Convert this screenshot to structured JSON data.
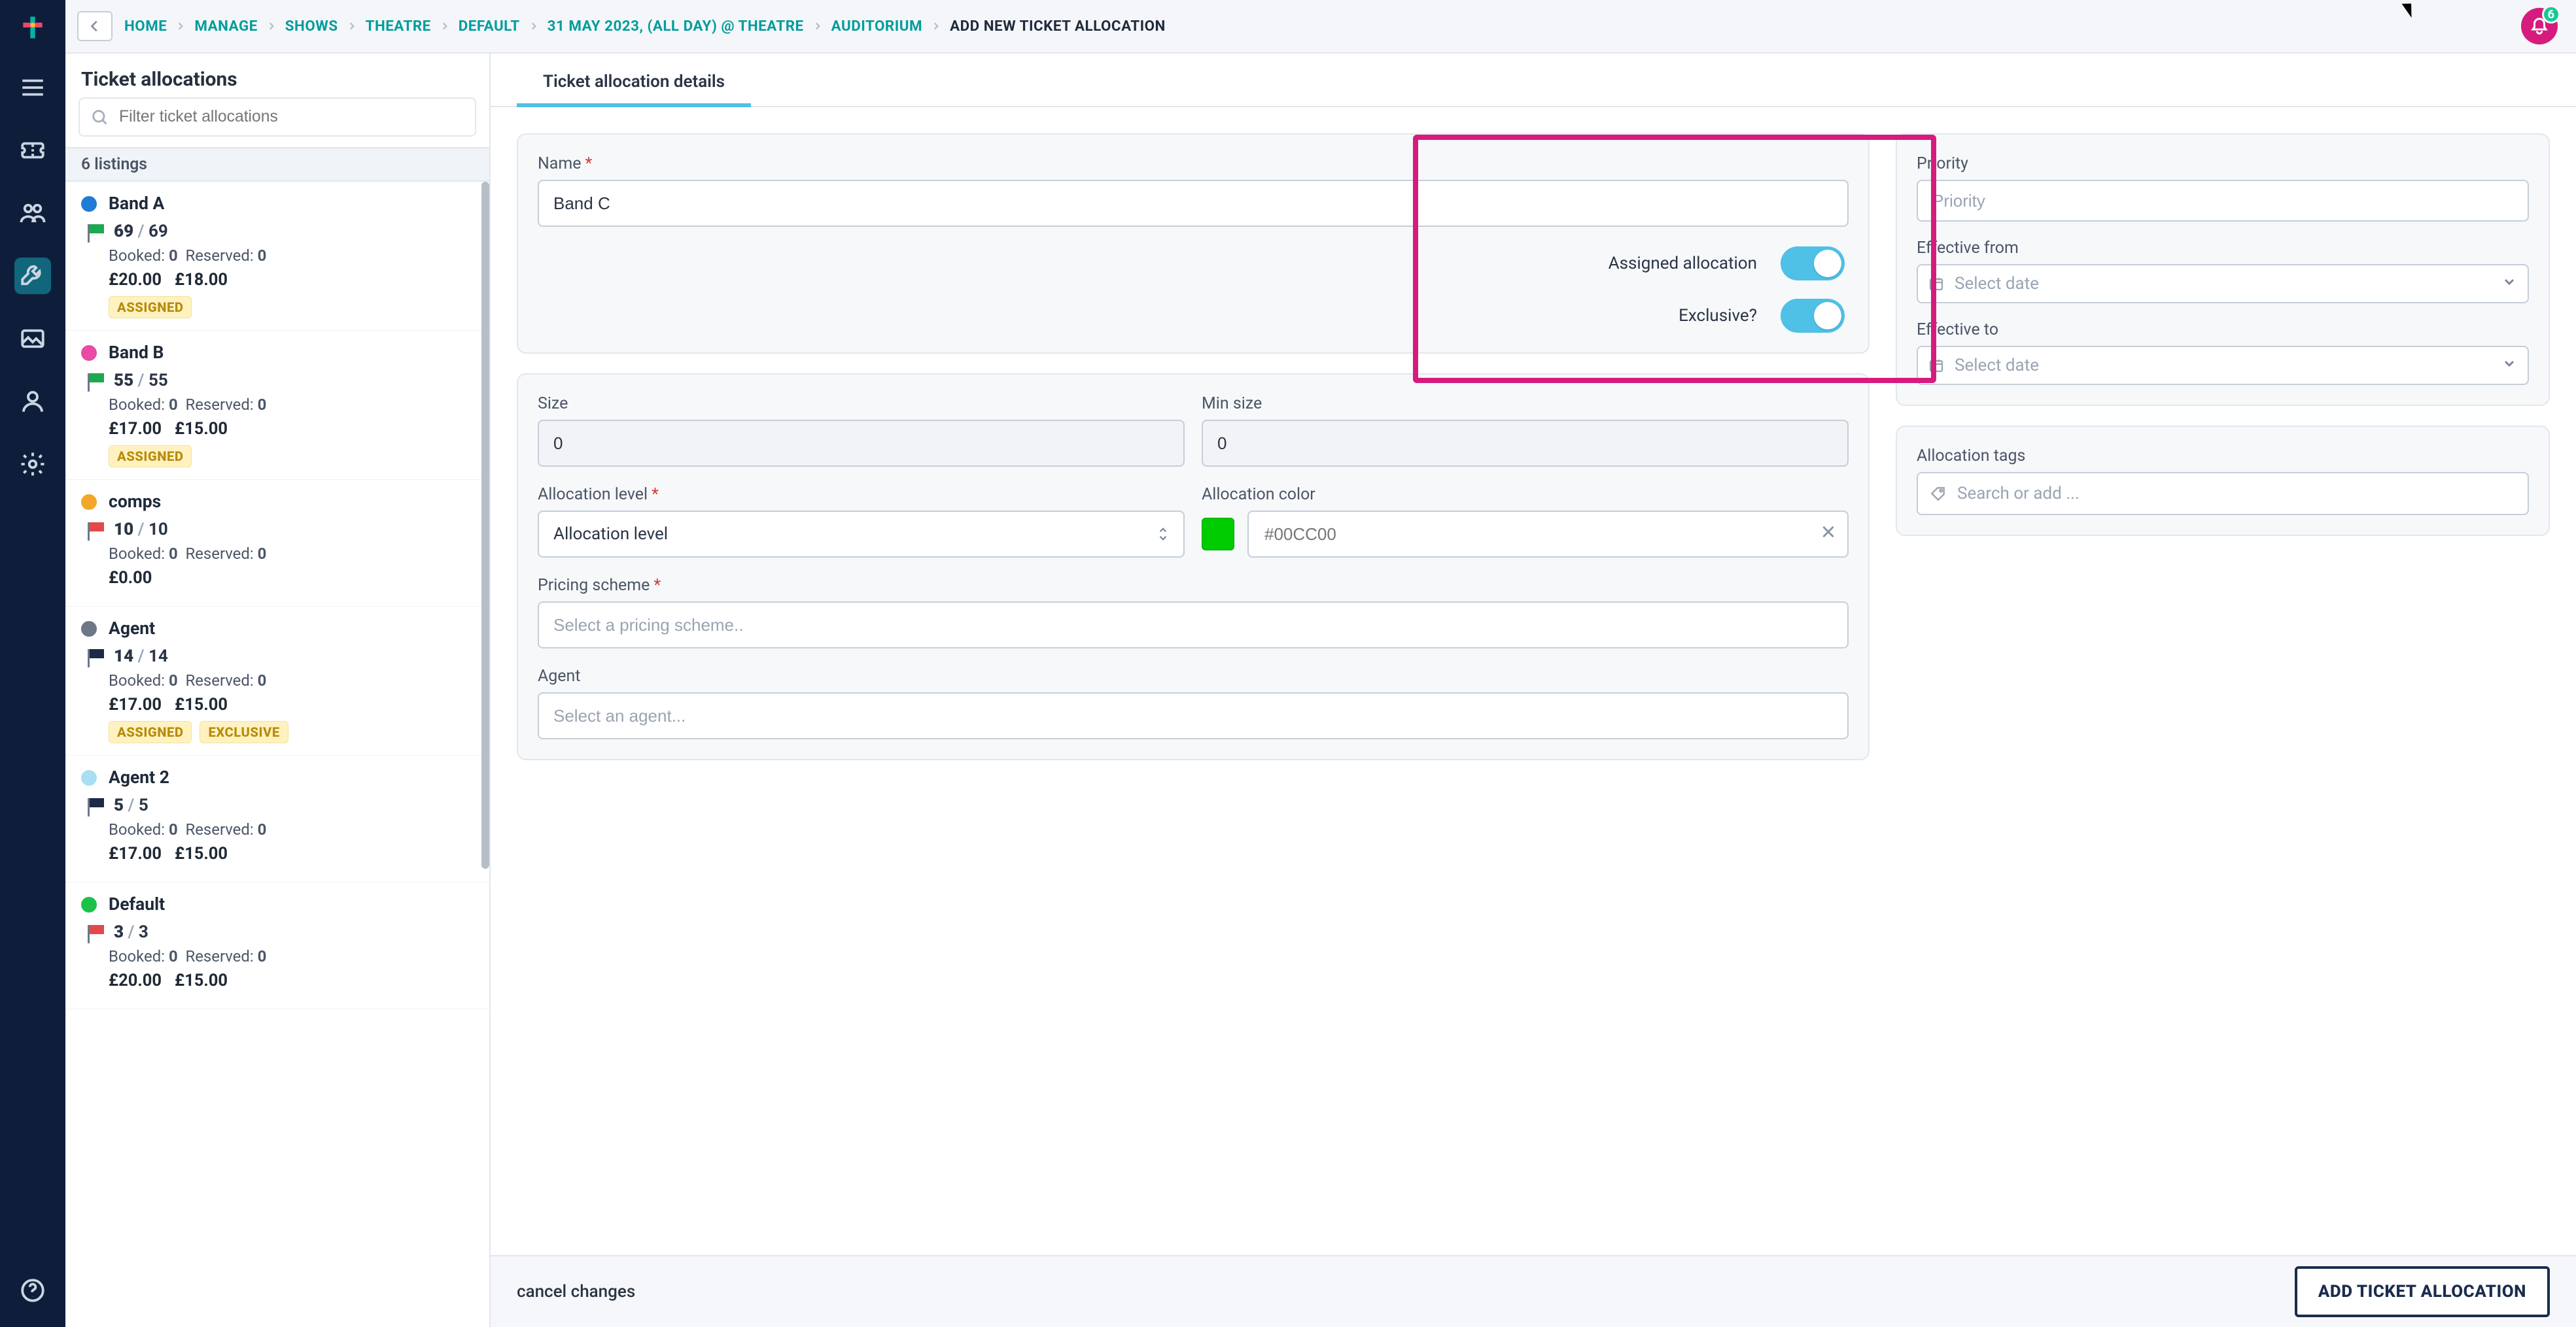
{
  "topbar": {
    "crumbs": [
      "HOME",
      "MANAGE",
      "SHOWS",
      "THEATRE",
      "DEFAULT",
      "31 MAY 2023, (ALL DAY) @ THEATRE",
      "AUDITORIUM"
    ],
    "final": "ADD NEW TICKET ALLOCATION",
    "badge": "6"
  },
  "listpanel": {
    "title": "Ticket allocations",
    "search_placeholder": "Filter ticket allocations",
    "count_label": "6 listings",
    "items": [
      {
        "name": "Band A",
        "dot": "#1f7bd6",
        "flag": "#1ea851",
        "v1": "69",
        "v2": "69",
        "booked_label": "Booked:",
        "booked": "0",
        "reserved_label": "Reserved:",
        "reserved": "0",
        "p1": "£20.00",
        "p2": "£18.00",
        "tags": [
          "ASSIGNED"
        ]
      },
      {
        "name": "Band B",
        "dot": "#e84aa4",
        "flag": "#1ea851",
        "v1": "55",
        "v2": "55",
        "booked_label": "Booked:",
        "booked": "0",
        "reserved_label": "Reserved:",
        "reserved": "0",
        "p1": "£17.00",
        "p2": "£15.00",
        "tags": [
          "ASSIGNED"
        ]
      },
      {
        "name": "comps",
        "dot": "#f3a72a",
        "flag": "#e24a4a",
        "v1": "10",
        "v2": "10",
        "booked_label": "Booked:",
        "booked": "0",
        "reserved_label": "Reserved:",
        "reserved": "0",
        "p1": "£0.00",
        "p2": "",
        "tags": []
      },
      {
        "name": "Agent",
        "dot": "#6d7786",
        "flag": "#1c2a48",
        "v1": "14",
        "v2": "14",
        "booked_label": "Booked:",
        "booked": "0",
        "reserved_label": "Reserved:",
        "reserved": "0",
        "p1": "£17.00",
        "p2": "£15.00",
        "tags": [
          "ASSIGNED",
          "EXCLUSIVE"
        ]
      },
      {
        "name": "Agent 2",
        "dot": "#a9dff3",
        "flag": "#1c2a48",
        "v1": "5",
        "v2": "5",
        "booked_label": "Booked:",
        "booked": "0",
        "reserved_label": "Reserved:",
        "reserved": "0",
        "p1": "£17.00",
        "p2": "£15.00",
        "tags": []
      },
      {
        "name": "Default",
        "dot": "#1bc24a",
        "flag": "#e24a4a",
        "v1": "3",
        "v2": "3",
        "booked_label": "Booked:",
        "booked": "0",
        "reserved_label": "Reserved:",
        "reserved": "0",
        "p1": "£20.00",
        "p2": "£15.00",
        "tags": []
      }
    ]
  },
  "details": {
    "tab": "Ticket allocation details",
    "name_label": "Name",
    "name_value": "Band C",
    "assigned_label": "Assigned allocation",
    "exclusive_label": "Exclusive?",
    "size_label": "Size",
    "size_value": "0",
    "minsize_label": "Min size",
    "minsize_value": "0",
    "allocationlevel_label": "Allocation level",
    "allocationlevel_value": "Allocation level",
    "allocationcolor_label": "Allocation color",
    "allocationcolor_value": "#00CC00",
    "allocationcolor_swatch": "#00cc00",
    "pricing_label": "Pricing scheme",
    "pricing_placeholder": "Select a pricing scheme..",
    "agent_label": "Agent",
    "agent_placeholder": "Select an agent...",
    "priority_label": "Priority",
    "priority_placeholder": "Priority",
    "eff_from_label": "Effective from",
    "eff_to_label": "Effective to",
    "date_placeholder": "Select date",
    "allotag_label": "Allocation tags",
    "allotag_placeholder": "Search or add ..."
  },
  "footer": {
    "cancel": "cancel changes",
    "cta": "ADD TICKET ALLOCATION"
  }
}
